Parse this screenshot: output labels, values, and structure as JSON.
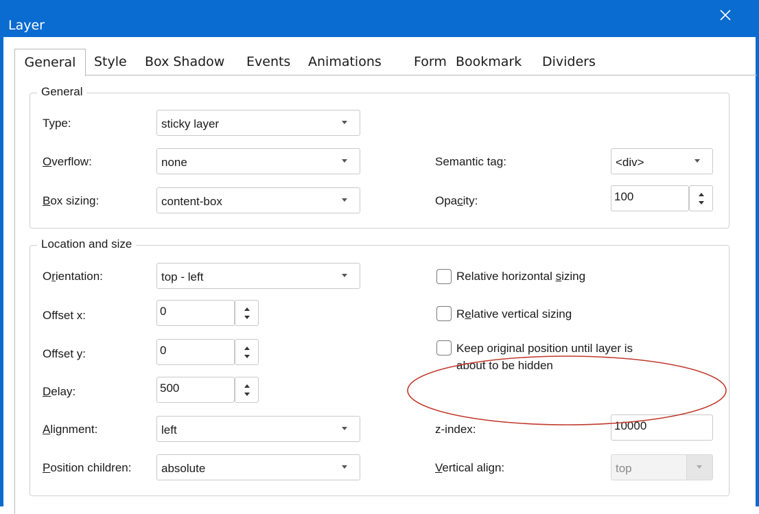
{
  "window": {
    "title": "Layer",
    "accent_color": "#0a6bd0",
    "close_icon": "close-icon"
  },
  "tabs": [
    {
      "label": "General",
      "active": true
    },
    {
      "label": "Style"
    },
    {
      "label": "Box Shadow"
    },
    {
      "label": "Events"
    },
    {
      "label": "Animations"
    },
    {
      "label": "Form"
    },
    {
      "label": "Bookmark"
    },
    {
      "label": "Dividers"
    }
  ],
  "general": {
    "title": "General",
    "type": {
      "label": "Type:",
      "value": "sticky layer"
    },
    "overflow": {
      "label_u": "O",
      "label_rest": "verflow:",
      "value": "none"
    },
    "box_sizing": {
      "label_u": "B",
      "label_rest": "ox sizing:",
      "value": "content-box"
    },
    "semantic_tag": {
      "label": "Semantic tag:",
      "value": "<div>"
    },
    "opacity": {
      "label_pre": "Opa",
      "label_u": "c",
      "label_rest": "ity:",
      "value": "100"
    }
  },
  "location": {
    "title": "Location and size",
    "orientation": {
      "label_pre": "O",
      "label_u": "r",
      "label_rest": "ientation:",
      "value": "top - left"
    },
    "offset_x": {
      "label": "Offset x:",
      "value": "0"
    },
    "offset_y": {
      "label": "Offset y:",
      "value": "0"
    },
    "delay": {
      "label_u": "D",
      "label_rest": "elay:",
      "value": "500"
    },
    "alignment": {
      "label_u": "A",
      "label_rest": "lignment:",
      "value": "left"
    },
    "position_children": {
      "label_u": "P",
      "label_rest": "osition children:",
      "value": "absolute"
    },
    "relative_h": {
      "label_pre": "Relative horizontal ",
      "label_u": "s",
      "label_rest": "izing",
      "checked": false
    },
    "relative_v": {
      "label_pre": "R",
      "label_u": "e",
      "label_rest": "lative vertical sizing",
      "checked": false
    },
    "keep_original": {
      "line1": "Keep original position until layer is",
      "line2": "about to be hidden",
      "checked": false
    },
    "z_index": {
      "label": "z-index:",
      "value": "10000"
    },
    "vertical_align": {
      "label_u": "V",
      "label_rest": "ertical align:",
      "value": "top",
      "disabled": true
    }
  },
  "annotation": {
    "color": "#c0392b"
  }
}
